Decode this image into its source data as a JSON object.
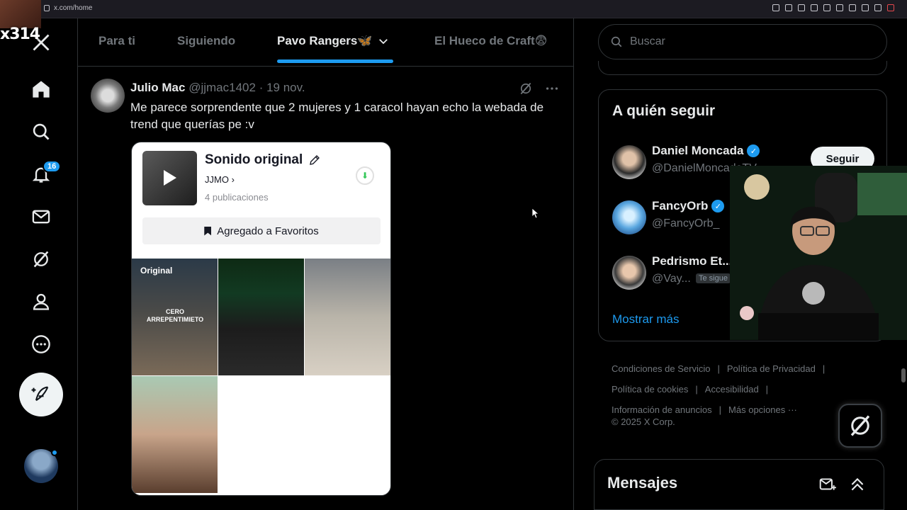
{
  "browser": {
    "url": "x.com/home"
  },
  "channel_tag": "x314",
  "nav": {
    "notifications_count": "16"
  },
  "tabs": [
    {
      "label": "Para ti"
    },
    {
      "label": "Siguiendo"
    },
    {
      "label": "Pavo Rangers🦋",
      "active": true
    },
    {
      "label": "El Hueco de Craft😨"
    }
  ],
  "tweet": {
    "name": "Julio Mac",
    "handle": "@jjmac1402",
    "separator": "·",
    "date": "19 nov.",
    "text": "Me parece sorprendente que 2 mujeres y 1 caracol hayan echo la webada de trend que querías pe :v",
    "media": {
      "sound_title": "Sonido original",
      "author": "JJMO",
      "author_chevron": "›",
      "post_count": "4 publicaciones",
      "favorites_label": "Agregado a Favoritos",
      "original_label": "Original",
      "cell_caption": "CERO ARREPENTIMIETO"
    }
  },
  "search": {
    "placeholder": "Buscar"
  },
  "who_to_follow": {
    "title": "A quién seguir",
    "users": [
      {
        "name": "Daniel Moncada",
        "handle": "@DanielMoncadaTV",
        "verified": true
      },
      {
        "name": "FancyOrb",
        "handle": "@FancyOrb_",
        "verified": true
      },
      {
        "name": "Pedrismo Et...",
        "handle": "@Vay...",
        "follows_you": "Te sigue"
      }
    ],
    "follow_label": "Seguir",
    "show_more": "Mostrar más"
  },
  "footer": {
    "links": [
      "Condiciones de Servicio",
      "Política de Privacidad",
      "Política de cookies",
      "Accesibilidad",
      "Información de anuncios",
      "Más opciones ···"
    ],
    "separator": "|",
    "copyright": "© 2025 X Corp."
  },
  "messages": {
    "title": "Mensajes"
  },
  "colors": {
    "accent": "#1d9bf0",
    "background": "#000000",
    "border": "#2f3336",
    "muted": "#71767b"
  }
}
